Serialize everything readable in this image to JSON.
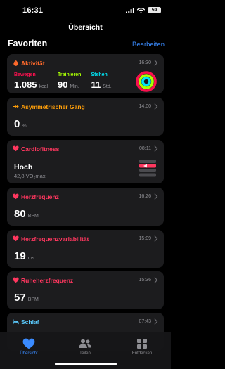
{
  "status": {
    "time": "16:31",
    "battery": "59"
  },
  "nav": {
    "title": "Übersicht"
  },
  "favorites": {
    "title": "Favoriten",
    "edit_label": "Bearbeiten"
  },
  "cards": {
    "activity": {
      "title": "Aktivität",
      "time": "16:30",
      "move": {
        "label": "Bewegen",
        "value": "1.085",
        "unit": "kcal"
      },
      "exercise": {
        "label": "Trainieren",
        "value": "90",
        "unit": "Min."
      },
      "stand": {
        "label": "Stehen",
        "value": "11",
        "unit": "Std."
      }
    },
    "gait": {
      "title": "Asymmetrischer Gang",
      "time": "14:00",
      "value": "0",
      "unit": "%"
    },
    "cardio": {
      "title": "Cardiofitness",
      "time": "08:11",
      "level": "Hoch",
      "detail": "42,8 VO₂max"
    },
    "heart_rate": {
      "title": "Herzfrequenz",
      "time": "16:26",
      "value": "80",
      "unit": "BPM"
    },
    "hrv": {
      "title": "Herzfrequenzvariabilität",
      "time": "15:09",
      "value": "19",
      "unit": "ms"
    },
    "resting_hr": {
      "title": "Ruheherzfrequenz",
      "time": "15:36",
      "value": "57",
      "unit": "BPM"
    },
    "sleep": {
      "title": "Schlaf",
      "time": "07:43"
    }
  },
  "tabbar": {
    "summary": "Übersicht",
    "sharing": "Teilen",
    "browse": "Entdecken"
  },
  "colors": {
    "heart": "#ff375f",
    "activity": "#ff6a2b",
    "gait": "#ff9f0a",
    "sleep": "#5ac8fa",
    "accent": "#3a8bff",
    "move": "#fa114f",
    "exercise": "#a8ff04",
    "stand": "#00e5f5"
  }
}
